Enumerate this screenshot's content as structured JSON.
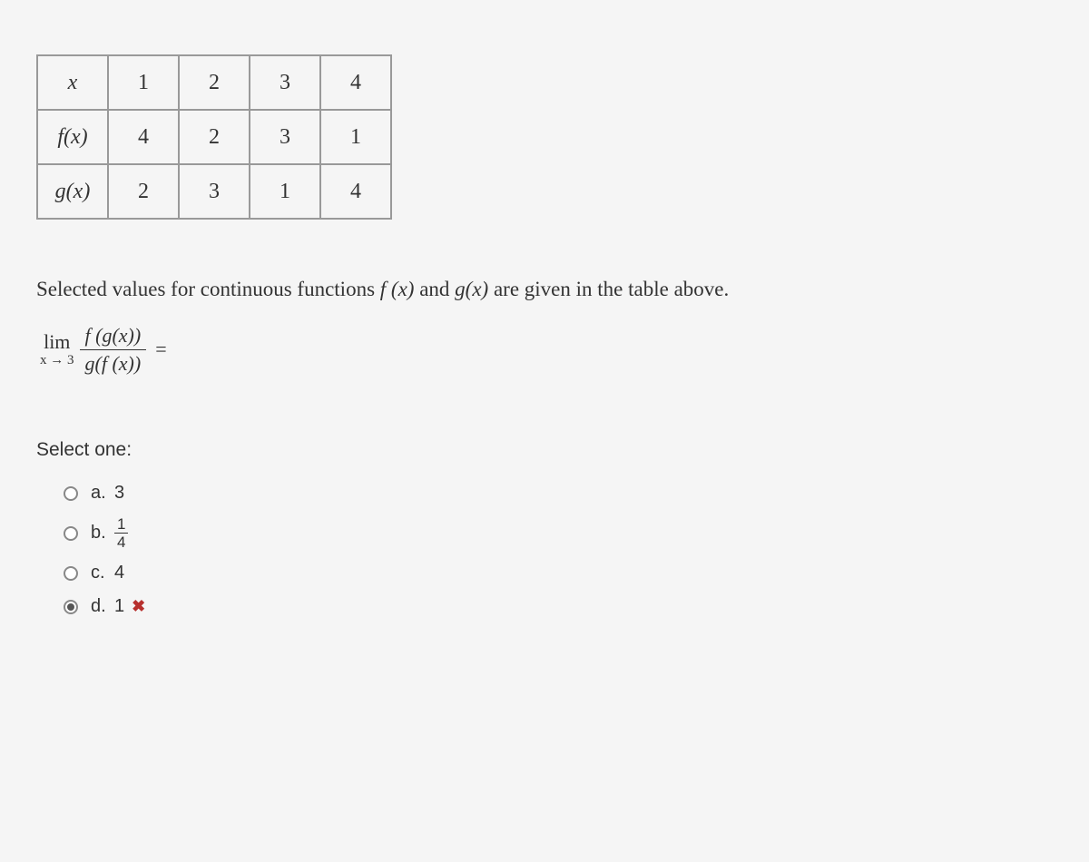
{
  "chart_data": {
    "type": "table",
    "headers": [
      "x",
      "1",
      "2",
      "3",
      "4"
    ],
    "rows": [
      {
        "label": "f(x)",
        "values": [
          "4",
          "2",
          "3",
          "1"
        ]
      },
      {
        "label": "g(x)",
        "values": [
          "2",
          "3",
          "1",
          "4"
        ]
      }
    ]
  },
  "question": {
    "text_prefix": "Selected values for continuous functions ",
    "f_label": "f (x)",
    "mid": " and ",
    "g_label": "g(x)",
    "text_suffix": " are given in the table above."
  },
  "limit": {
    "lim": "lim",
    "sub": "x → 3",
    "numerator": "f (g(x))",
    "denominator": "g(f (x))",
    "equals": "="
  },
  "select_label": "Select one:",
  "options": [
    {
      "letter": "a.",
      "value": "3",
      "is_fraction": false,
      "selected": false,
      "wrong": false
    },
    {
      "letter": "b.",
      "value": "",
      "is_fraction": true,
      "frac_top": "1",
      "frac_bot": "4",
      "selected": false,
      "wrong": false
    },
    {
      "letter": "c.",
      "value": "4",
      "is_fraction": false,
      "selected": false,
      "wrong": false
    },
    {
      "letter": "d.",
      "value": "1",
      "is_fraction": false,
      "selected": true,
      "wrong": true
    }
  ],
  "wrong_symbol": "✖"
}
